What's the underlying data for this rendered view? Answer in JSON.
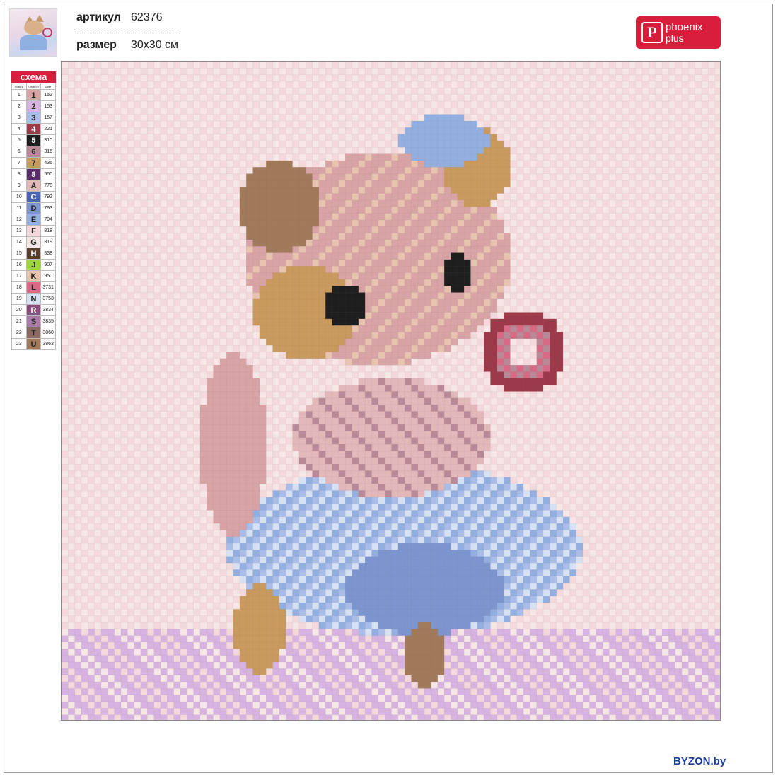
{
  "article": {
    "label": "артикул",
    "value": "62376"
  },
  "size": {
    "label": "размер",
    "value": "30x30 см"
  },
  "logo": {
    "mark": "P",
    "line1": "phoenix",
    "line2": "plus"
  },
  "legend": {
    "title": "схема",
    "columns": [
      "Номер",
      "Символ",
      "Цвет"
    ],
    "rows": [
      {
        "num": "1",
        "sym": "1",
        "code": "152",
        "color": "#d8a3a5"
      },
      {
        "num": "2",
        "sym": "2",
        "code": "153",
        "color": "#d6b3e0"
      },
      {
        "num": "3",
        "sym": "3",
        "code": "157",
        "color": "#a9bde8"
      },
      {
        "num": "4",
        "sym": "4",
        "code": "221",
        "color": "#9c3a4a"
      },
      {
        "num": "5",
        "sym": "5",
        "code": "310",
        "color": "#1e1e1e"
      },
      {
        "num": "6",
        "sym": "6",
        "code": "316",
        "color": "#b88a98"
      },
      {
        "num": "7",
        "sym": "7",
        "code": "436",
        "color": "#c99a5d"
      },
      {
        "num": "8",
        "sym": "8",
        "code": "550",
        "color": "#5a2d6a"
      },
      {
        "num": "9",
        "sym": "A",
        "code": "778",
        "color": "#e2b8ba"
      },
      {
        "num": "10",
        "sym": "C",
        "code": "792",
        "color": "#4a64b0"
      },
      {
        "num": "11",
        "sym": "D",
        "code": "793",
        "color": "#7d95cf"
      },
      {
        "num": "12",
        "sym": "E",
        "code": "794",
        "color": "#93afe0"
      },
      {
        "num": "13",
        "sym": "F",
        "code": "818",
        "color": "#f3d9dc"
      },
      {
        "num": "14",
        "sym": "G",
        "code": "819",
        "color": "#f6e7e6"
      },
      {
        "num": "15",
        "sym": "H",
        "code": "838",
        "color": "#5a3f2e"
      },
      {
        "num": "16",
        "sym": "J",
        "code": "907",
        "color": "#9fd640"
      },
      {
        "num": "17",
        "sym": "K",
        "code": "950",
        "color": "#e8c4b0"
      },
      {
        "num": "18",
        "sym": "L",
        "code": "3731",
        "color": "#d86a86"
      },
      {
        "num": "19",
        "sym": "N",
        "code": "3753",
        "color": "#d6e2f3"
      },
      {
        "num": "20",
        "sym": "R",
        "code": "3834",
        "color": "#8a4a7a"
      },
      {
        "num": "21",
        "sym": "S",
        "code": "3835",
        "color": "#a87aa5"
      },
      {
        "num": "22",
        "sym": "T",
        "code": "3860",
        "color": "#8a6a62"
      },
      {
        "num": "23",
        "sym": "U",
        "code": "3863",
        "color": "#a07a5a"
      }
    ]
  },
  "watermark": "BYZON.by"
}
